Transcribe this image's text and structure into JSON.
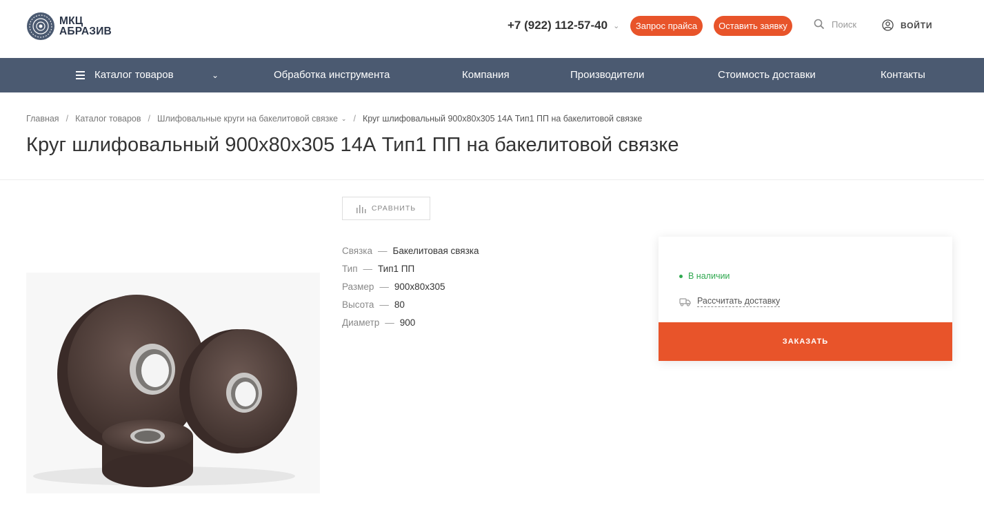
{
  "header": {
    "logo_line1": "МКЦ",
    "logo_line2": "АБРАЗИВ",
    "phone": "+7 (922) 112-57-40",
    "price_request_label": "Запрос прайса",
    "leave_request_label": "Оставить заявку",
    "search_placeholder": "Поиск",
    "login_label": "ВОЙТИ"
  },
  "nav": {
    "items": [
      {
        "label": "Каталог товаров",
        "icon": "menu-icon"
      },
      {
        "label": "Обработка инструмента"
      },
      {
        "label": "Компания"
      },
      {
        "label": "Производители"
      },
      {
        "label": "Стоимость доставки"
      },
      {
        "label": "Контакты"
      }
    ]
  },
  "breadcrumb": {
    "items": [
      "Главная",
      "Каталог товаров",
      "Шлифовальные круги на бакелитовой связке"
    ],
    "current": "Круг шлифовальный 900x80x305 14А Тип1 ПП на бакелитовой связке"
  },
  "page_title": "Круг шлифовальный 900x80x305 14А Тип1 ПП на бакелитовой связке",
  "compare_label": "СРАВНИТЬ",
  "properties": [
    {
      "name": "Связка",
      "value": "Бакелитовая связка"
    },
    {
      "name": "Тип",
      "value": "Тип1 ПП"
    },
    {
      "name": "Размер",
      "value": "900x80x305"
    },
    {
      "name": "Высота",
      "value": "80"
    },
    {
      "name": "Диаметр",
      "value": "900"
    }
  ],
  "card": {
    "stock": "В наличии",
    "delivery": "Рассчитать доставку",
    "order_label": "ЗАКАЗАТЬ"
  },
  "colors": {
    "accent": "#e8542a",
    "nav_bg": "#4b5a71",
    "in_stock": "#2fa84f"
  }
}
